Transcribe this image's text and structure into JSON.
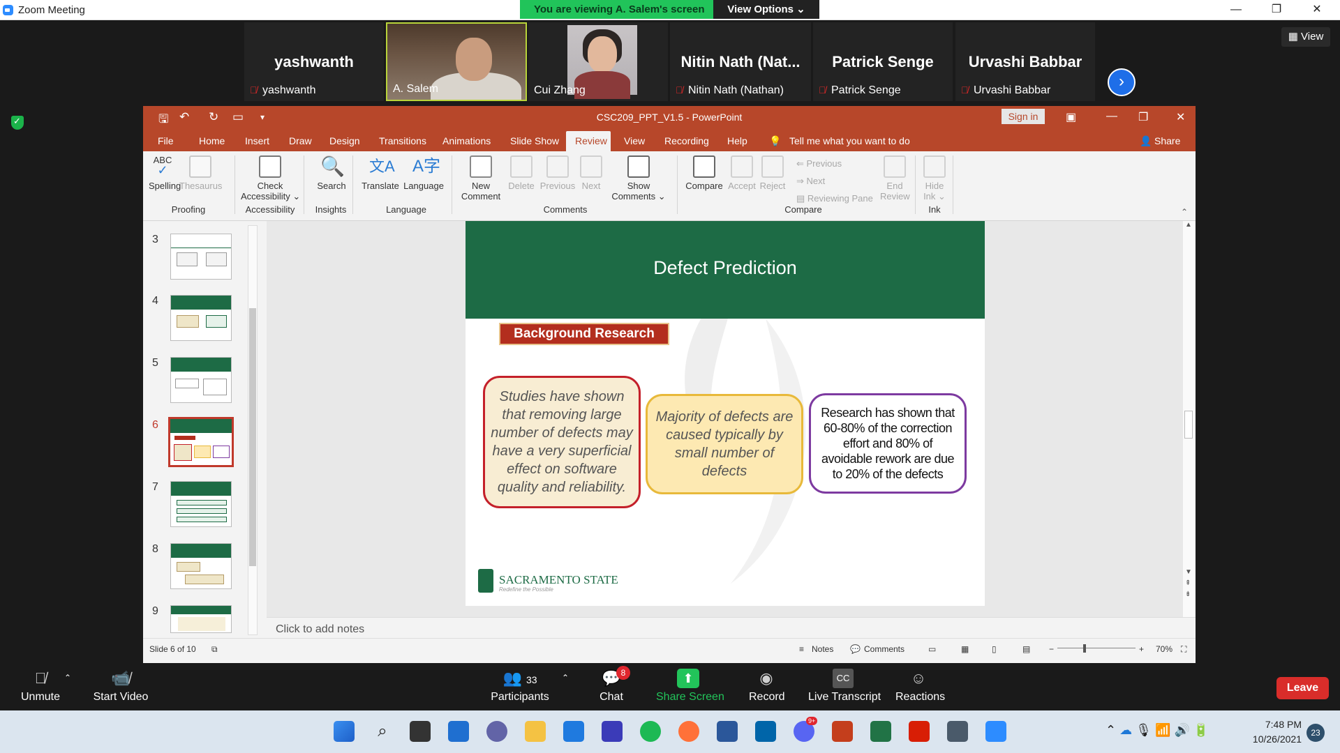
{
  "window": {
    "title": "Zoom Meeting",
    "minimize": "—",
    "restore": "❐",
    "close": "✕"
  },
  "banner": {
    "viewing": "You are viewing A. Salem's screen",
    "view_options": "View Options ⌄"
  },
  "participants_strip": [
    {
      "big": "yashwanth",
      "label": "yashwanth",
      "muted": true
    },
    {
      "big": "",
      "label": "A. Salem",
      "muted": false
    },
    {
      "big": "",
      "label": "Cui Zhang",
      "muted": false
    },
    {
      "big": "Nitin Nath (Nat...",
      "label": "Nitin Nath (Nathan)",
      "muted": true
    },
    {
      "big": "Patrick Senge",
      "label": "Patrick Senge",
      "muted": true
    },
    {
      "big": "Urvashi Babbar",
      "label": "Urvashi Babbar",
      "muted": true
    }
  ],
  "view_button": "▦ View",
  "ppt": {
    "title": "CSC209_PPT_V1.5  -  PowerPoint",
    "sign_in": "Sign in",
    "tabs": [
      "File",
      "Home",
      "Insert",
      "Draw",
      "Design",
      "Transitions",
      "Animations",
      "Slide Show",
      "Review",
      "View",
      "Recording",
      "Help"
    ],
    "tell_me": "Tell me what you want to do",
    "share": "Share",
    "ribbon": {
      "spelling": "Spelling",
      "thesaurus": "Thesaurus",
      "check_accessibility_1": "Check",
      "check_accessibility_2": "Accessibility ⌄",
      "search": "Search",
      "translate": "Translate",
      "language": "Language",
      "new_comment_1": "New",
      "new_comment_2": "Comment",
      "delete": "Delete",
      "previous": "Previous",
      "next": "Next",
      "show_comments_1": "Show",
      "show_comments_2": "Comments ⌄",
      "compare": "Compare",
      "accept": "Accept",
      "reject": "Reject",
      "cmp_previous": "Previous",
      "cmp_next": "Next",
      "reviewing_pane": "Reviewing Pane",
      "end_review_1": "End",
      "end_review_2": "Review",
      "hide_ink_1": "Hide",
      "hide_ink_2": "Ink ⌄",
      "abc": "ABC",
      "groups": [
        "Proofing",
        "Accessibility",
        "Insights",
        "Language",
        "Comments",
        "Compare",
        "Ink"
      ]
    },
    "thumbnails": [
      "3",
      "4",
      "5",
      "6",
      "7",
      "8",
      "9"
    ],
    "selected_slide": "6",
    "slide": {
      "title": "Defect Prediction",
      "section": "Background  Research",
      "bubble1": "Studies have shown that removing large number of defects may have a very superficial effect on software quality and reliability.",
      "bubble2": "Majority of defects are caused typically by small number of defects",
      "bubble3": "Research has shown that 60-80% of the correction effort and 80% of avoidable rework are due to 20% of the defects",
      "logo": "SACRAMENTO STATE",
      "logo_tag": "Redefine the Possible"
    },
    "notes_placeholder": "Click to add notes",
    "status": {
      "slide_of": "Slide 6 of 10",
      "notes": "Notes",
      "comments": "Comments",
      "zoom": "70%",
      "zoom_minus": "−",
      "zoom_plus": "+"
    }
  },
  "toolbar": {
    "unmute": "Unmute",
    "start_video": "Start Video",
    "participants": "Participants",
    "participants_count": "33",
    "chat": "Chat",
    "chat_badge": "8",
    "share_screen": "Share Screen",
    "record": "Record",
    "live_transcript": "Live Transcript",
    "reactions": "Reactions",
    "leave": "Leave"
  },
  "taskbar": {
    "time": "7:48 PM",
    "date": "10/26/2021",
    "notifications": "23",
    "discord_badge": "9+"
  },
  "colors": {
    "ppt_accent": "#b7472a",
    "slide_green": "#1d6b45",
    "zoom_green": "#22c45a",
    "leave_red": "#d92d2a"
  }
}
